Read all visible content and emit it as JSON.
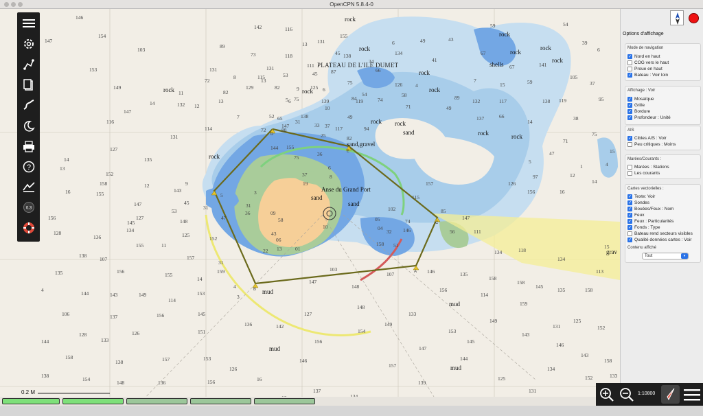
{
  "window": {
    "title": "OpenCPN 5.8.4-0"
  },
  "map": {
    "region_title": "PLATEAU DE L'ILE DUMET",
    "place_names": [
      "Anse du Grand Port",
      "Ile Dumet"
    ],
    "seabed_labels": [
      {
        "text": "rock"
      },
      {
        "text": "rock"
      },
      {
        "text": "rock"
      },
      {
        "text": "rock"
      },
      {
        "text": "rock"
      },
      {
        "text": "rock"
      },
      {
        "text": "rock"
      },
      {
        "text": "rock"
      },
      {
        "text": "rock"
      },
      {
        "text": "rock"
      },
      {
        "text": "rock"
      },
      {
        "text": "rock"
      },
      {
        "text": "rock"
      },
      {
        "text": "rock"
      },
      {
        "text": "rock"
      },
      {
        "text": "sand"
      },
      {
        "text": "sand"
      },
      {
        "text": "sand"
      },
      {
        "text": "sand,gravel"
      },
      {
        "text": "mud"
      },
      {
        "text": "mud"
      },
      {
        "text": "mud"
      },
      {
        "text": "mud"
      },
      {
        "text": "shells"
      },
      {
        "text": "grav"
      }
    ],
    "soundings": [
      "146",
      "154",
      "147",
      "15",
      "153",
      "142",
      "131",
      "116",
      "13",
      "103",
      "147",
      "158",
      "127",
      "116",
      "127",
      "135",
      "14",
      "13",
      "16",
      "152",
      "9",
      "145",
      "14",
      "147",
      "12",
      "143",
      "149",
      "11",
      "131",
      "132",
      "12",
      "89",
      "155",
      "114",
      "7",
      "13",
      "82",
      "8",
      "72",
      "129",
      "73",
      "115",
      "13",
      "131",
      "82",
      "138",
      "75",
      "118",
      "53",
      "36",
      "6",
      "9",
      "52",
      "65",
      "88",
      "72",
      "5",
      "131",
      "45",
      "125",
      "155",
      "10",
      "111",
      "6",
      "139",
      "87",
      "45",
      "138",
      "75",
      "84",
      "119",
      "49",
      "34",
      "31",
      "33",
      "37",
      "117",
      "25",
      "82",
      "66",
      "54",
      "74",
      "94",
      "6",
      "134",
      "126",
      "58",
      "71",
      "4",
      "49",
      "41",
      "43",
      "49",
      "89",
      "7",
      "132",
      "137",
      "67",
      "59",
      "15",
      "117",
      "66",
      "67",
      "59",
      "14",
      "138",
      "141",
      "105",
      "119",
      "38",
      "95",
      "37",
      "6",
      "39",
      "54",
      "75",
      "71",
      "47",
      "5",
      "97",
      "156",
      "126",
      "12",
      "1",
      "4",
      "14",
      "15",
      "16",
      "156",
      "128",
      "136",
      "134",
      "155",
      "11",
      "125",
      "148",
      "152",
      "138",
      "107",
      "156",
      "155",
      "157",
      "135",
      "4",
      "144",
      "143",
      "149",
      "14",
      "159",
      "153",
      "114",
      "106",
      "137",
      "156",
      "145",
      "128",
      "133",
      "126",
      "151",
      "144",
      "158",
      "138",
      "157",
      "153",
      "138",
      "154",
      "148",
      "136",
      "156",
      "126",
      "16",
      "136",
      "142",
      "127",
      "156",
      "146",
      "137",
      "16",
      "134",
      "148",
      "154",
      "149",
      "157",
      "133",
      "147",
      "139",
      "156",
      "153",
      "145",
      "144",
      "114",
      "149",
      "125",
      "158",
      "159",
      "143",
      "131",
      "131",
      "146",
      "134",
      "125",
      "143",
      "152",
      "152",
      "158",
      "133",
      "158",
      "135",
      "145",
      "158",
      "134",
      "118",
      "134",
      "15",
      "113",
      "135",
      "146",
      "107",
      "148",
      "147",
      "103",
      "158",
      "85",
      "111",
      "147",
      "115",
      "102",
      "157",
      "4",
      "3",
      "31",
      "47",
      "31",
      "53",
      "45",
      "43",
      "5",
      "3",
      "36",
      "6",
      "8",
      "37",
      "19",
      "10",
      "58",
      "31",
      "06",
      "13",
      "01",
      "22",
      "09",
      "05",
      "04",
      "32",
      "51",
      "56",
      "74",
      "146",
      "155",
      "75",
      "144",
      "147"
    ],
    "scale_bar_label": "0.2 M",
    "waypoint_labels": [
      "D",
      "E",
      "C",
      "A",
      "B"
    ]
  },
  "toolbar": {
    "items": [
      {
        "name": "menu-icon"
      },
      {
        "name": "settings-icon"
      },
      {
        "name": "route-icon"
      },
      {
        "name": "route-manager-icon"
      },
      {
        "name": "track-icon"
      },
      {
        "name": "night-mode-icon"
      },
      {
        "name": "print-icon"
      },
      {
        "name": "help-icon"
      },
      {
        "name": "ais-icon"
      },
      {
        "name": "quilting-icon"
      },
      {
        "name": "mob-icon"
      }
    ]
  },
  "panel": {
    "title": "Options d'affichage",
    "nav": {
      "header": "Mode de navigation",
      "items": [
        {
          "label": "Nord en haut",
          "checked": true
        },
        {
          "label": "COG vers le haut",
          "checked": false
        },
        {
          "label": "Proue en haut",
          "checked": false
        },
        {
          "label": "Bateau : Voir loin",
          "checked": true
        }
      ]
    },
    "view": {
      "header": "Affichage : Voir",
      "items": [
        {
          "label": "Mosaïque",
          "checked": true
        },
        {
          "label": "Grille",
          "checked": true
        },
        {
          "label": "Bordure",
          "checked": true
        },
        {
          "label": "Profondeur : Unité",
          "checked": true
        }
      ]
    },
    "ais": {
      "header": "AIS",
      "items": [
        {
          "label": "Cibles AIS : Voir",
          "checked": true
        },
        {
          "label": "Peu critiques : Moins",
          "checked": false
        }
      ]
    },
    "tides": {
      "header": "Marées/Courants :",
      "items": [
        {
          "label": "Marées : Stations",
          "checked": false
        },
        {
          "label": "Les courants",
          "checked": false
        }
      ]
    },
    "vector": {
      "header": "Cartes vectorielles :",
      "items": [
        {
          "label": "Texte: Voir",
          "checked": true
        },
        {
          "label": "Sondes",
          "checked": true
        },
        {
          "label": "Bouées/Feux : Nom",
          "checked": true
        },
        {
          "label": "Feux",
          "checked": true
        },
        {
          "label": "Feux : Particularités",
          "checked": true
        },
        {
          "label": "Fonds : Type",
          "checked": true
        },
        {
          "label": "Bateau rend secteurs visibles",
          "checked": false
        },
        {
          "label": "Qualité données cartes : Voir",
          "checked": true
        }
      ]
    },
    "content": {
      "header": "Contenu affiché",
      "select": "Tout"
    }
  },
  "zoom": {
    "scale": "1:10800"
  },
  "colors": {
    "land": "#f6cf98",
    "shallow": "#73a7e4",
    "mid": "#a8cdea",
    "deep": "#c6def0",
    "intertidal": "#a9cc9a",
    "route": "#6b6a1c",
    "panel_accent": "#2a73e8"
  }
}
